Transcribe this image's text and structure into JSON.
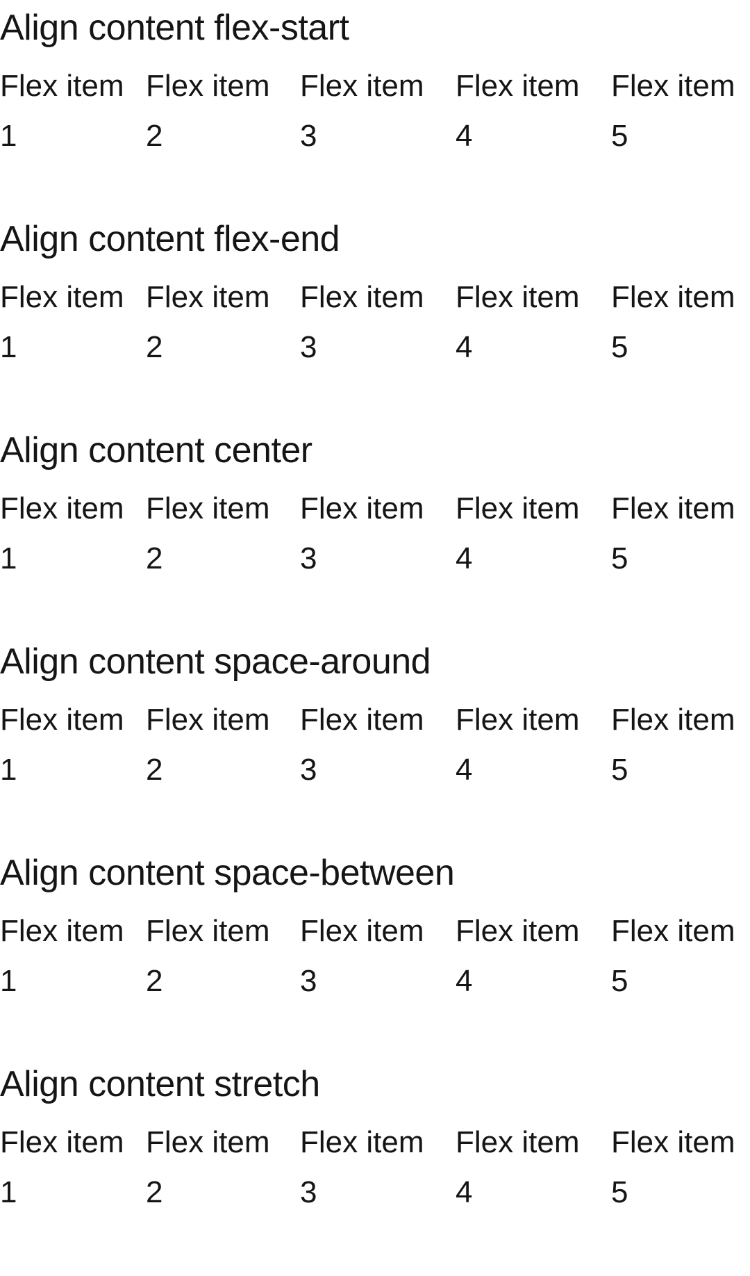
{
  "sections": [
    {
      "title": "Align content flex-start",
      "items": [
        {
          "label": "Flex item",
          "num": "1"
        },
        {
          "label": "Flex item",
          "num": "2"
        },
        {
          "label": "Flex item",
          "num": "3"
        },
        {
          "label": "Flex item",
          "num": "4"
        },
        {
          "label": "Flex item",
          "num": "5"
        }
      ]
    },
    {
      "title": "Align content flex-end",
      "items": [
        {
          "label": "Flex item",
          "num": "1"
        },
        {
          "label": "Flex item",
          "num": "2"
        },
        {
          "label": "Flex item",
          "num": "3"
        },
        {
          "label": "Flex item",
          "num": "4"
        },
        {
          "label": "Flex item",
          "num": "5"
        }
      ]
    },
    {
      "title": "Align content center",
      "items": [
        {
          "label": "Flex item",
          "num": "1"
        },
        {
          "label": "Flex item",
          "num": "2"
        },
        {
          "label": "Flex item",
          "num": "3"
        },
        {
          "label": "Flex item",
          "num": "4"
        },
        {
          "label": "Flex item",
          "num": "5"
        }
      ]
    },
    {
      "title": "Align content space-around",
      "items": [
        {
          "label": "Flex item",
          "num": "1"
        },
        {
          "label": "Flex item",
          "num": "2"
        },
        {
          "label": "Flex item",
          "num": "3"
        },
        {
          "label": "Flex item",
          "num": "4"
        },
        {
          "label": "Flex item",
          "num": "5"
        }
      ]
    },
    {
      "title": "Align content space-between",
      "items": [
        {
          "label": "Flex item",
          "num": "1"
        },
        {
          "label": "Flex item",
          "num": "2"
        },
        {
          "label": "Flex item",
          "num": "3"
        },
        {
          "label": "Flex item",
          "num": "4"
        },
        {
          "label": "Flex item",
          "num": "5"
        }
      ]
    },
    {
      "title": "Align content stretch",
      "items": [
        {
          "label": "Flex item",
          "num": "1"
        },
        {
          "label": "Flex item",
          "num": "2"
        },
        {
          "label": "Flex item",
          "num": "3"
        },
        {
          "label": "Flex item",
          "num": "4"
        },
        {
          "label": "Flex item",
          "num": "5"
        }
      ]
    }
  ]
}
